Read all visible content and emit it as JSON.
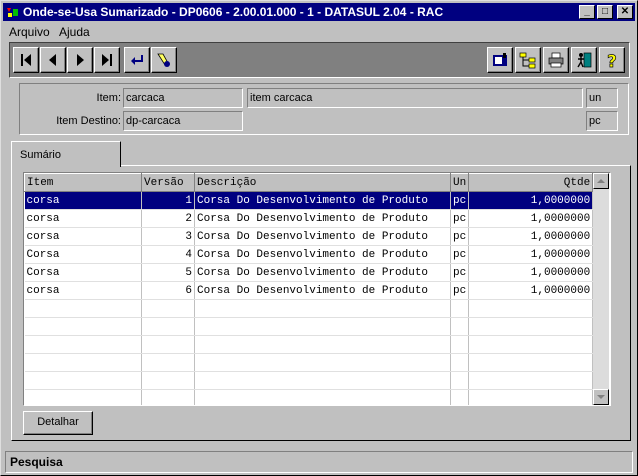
{
  "window": {
    "title": "Onde-se-Usa Sumarizado - DP0606 - 2.00.01.000 - 1 - DATASUL 2.04 - RAC",
    "minimize_glyph": "_",
    "maximize_glyph": "□",
    "close_glyph": "✕"
  },
  "menu": {
    "arquivo": "Arquivo",
    "ajuda": "Ajuda"
  },
  "header": {
    "item_label": "Item:",
    "item_code": "carcaca",
    "item_desc": "item carcaca",
    "item_un": "un",
    "dest_label": "Item Destino:",
    "dest_code": "dp-carcaca",
    "dest_un": "pc"
  },
  "tabs": {
    "sumario": "Sumário"
  },
  "grid": {
    "columns": [
      "Item",
      "Versão",
      "Descrição",
      "Un",
      "Qtde"
    ],
    "rows": [
      [
        "corsa",
        "1",
        "Corsa Do Desenvolvimento de Produto",
        "pc",
        "1,0000000"
      ],
      [
        "corsa",
        "2",
        "Corsa Do Desenvolvimento de Produto",
        "pc",
        "1,0000000"
      ],
      [
        "corsa",
        "3",
        "Corsa Do Desenvolvimento de Produto",
        "pc",
        "1,0000000"
      ],
      [
        "Corsa",
        "4",
        "Corsa Do Desenvolvimento de Produto",
        "pc",
        "1,0000000"
      ],
      [
        "Corsa",
        "5",
        "Corsa Do Desenvolvimento de Produto",
        "pc",
        "1,0000000"
      ],
      [
        "corsa",
        "6",
        "Corsa Do Desenvolvimento de Produto",
        "pc",
        "1,0000000"
      ]
    ],
    "selected_row": 0
  },
  "buttons": {
    "detalhar": "Detalhar"
  },
  "status": {
    "text": "Pesquisa"
  },
  "toolbar_icons": [
    "first-record-icon",
    "previous-record-icon",
    "next-record-icon",
    "last-record-icon",
    "goto-icon",
    "search-flashlight-icon",
    "report-icon",
    "tree-structure-icon",
    "print-icon",
    "exit-icon",
    "help-icon"
  ],
  "colors": {
    "title_bar": "#000080",
    "selection": "#000080",
    "face": "#c0c0c0",
    "toolbar_bg": "#808080"
  }
}
